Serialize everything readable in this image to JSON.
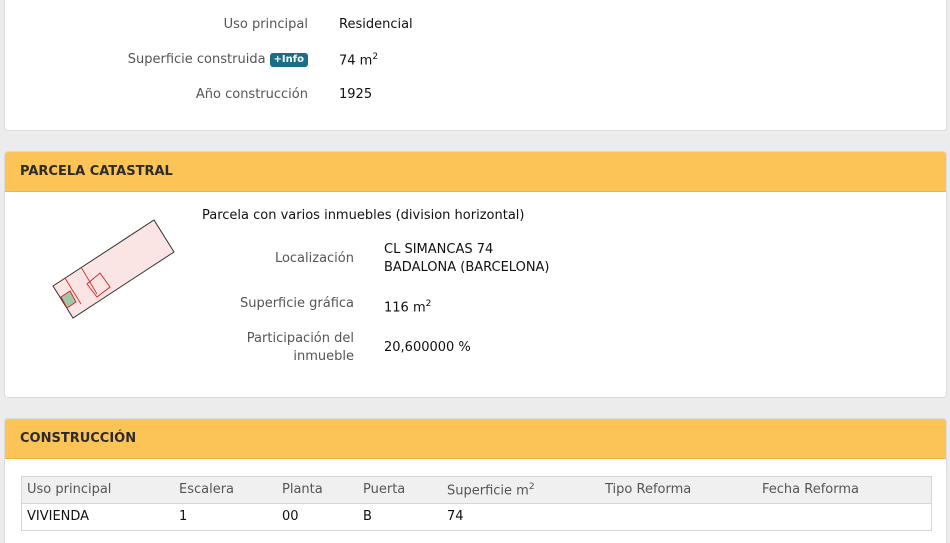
{
  "inmueble": {
    "uso_label": "Uso principal",
    "uso_value": "Residencial",
    "superficie_label": "Superficie construida",
    "info_badge": "+Info",
    "superficie_value": "74 m",
    "superficie_unit_sup": "2",
    "anio_label": "Año construcción",
    "anio_value": "1925"
  },
  "parcela": {
    "header": "PARCELA CATASTRAL",
    "title": "Parcela con varios inmuebles (division horizontal)",
    "localizacion_label": "Localización",
    "localizacion_line1": "CL SIMANCAS 74",
    "localizacion_line2": "BADALONA (BARCELONA)",
    "superficie_label": "Superficie gráfica",
    "superficie_value": "116 m",
    "superficie_unit_sup": "2",
    "participacion_label_line1": "Participación del",
    "participacion_label_line2": "inmueble",
    "participacion_value": "20,600000 %",
    "colors": {
      "fill": "#fbe4e4",
      "stroke_red": "#d42020",
      "stroke_dark": "#333333",
      "fill_green": "#9ec9a8"
    }
  },
  "construccion": {
    "header": "CONSTRUCCIÓN",
    "columns": [
      "Uso principal",
      "Escalera",
      "Planta",
      "Puerta",
      "Superficie m",
      "Tipo Reforma",
      "Fecha Reforma"
    ],
    "superficie_col_sup": "2",
    "rows": [
      [
        "VIVIENDA",
        "1",
        "00",
        "B",
        "74",
        "",
        ""
      ]
    ]
  }
}
